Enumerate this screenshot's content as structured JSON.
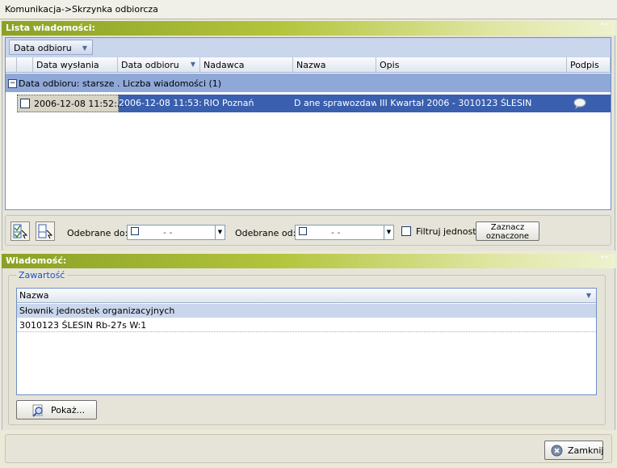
{
  "breadcrumb": "Komunikacja->Skrzynka odbiorcza",
  "list_panel": {
    "title": "Lista wiadomości:"
  },
  "message_panel": {
    "title": "Wiadomość:"
  },
  "group_by_button": "Data odbioru",
  "columns": [
    "Data wysłania",
    "Data odbioru",
    "Nadawca",
    "Nazwa",
    "Opis",
    "Podpis"
  ],
  "group_row": "Data odbioru:  starsze . Liczba wiadomości (1)",
  "rows": [
    {
      "sent": "2006-12-08  11:52:...",
      "received": "2006-12-08  11:53:...",
      "sender": "RIO Poznań",
      "name": "D ane  sprawozdaw...",
      "description": "III Kwartał 2006  -  3010123 ŚLESIN",
      "signature_icon": "signed-message-icon"
    }
  ],
  "filters": {
    "received_to_label": "Odebrane do:",
    "received_to_value": "-   -",
    "received_from_label": "Odebrane od:",
    "received_from_value": "-   -",
    "filter_units_label": "Filtruj jednostki",
    "mark_selected_label": "Zaznacz oznaczone"
  },
  "content": {
    "legend": "Zawartość",
    "column": "Nazwa",
    "items": [
      "Słownik jednostek organizacyjnych",
      "3010123  ŚLESIN   Rb-27s   W:1"
    ],
    "show_button": "Pokaż..."
  },
  "close_button": "Zamknij"
}
